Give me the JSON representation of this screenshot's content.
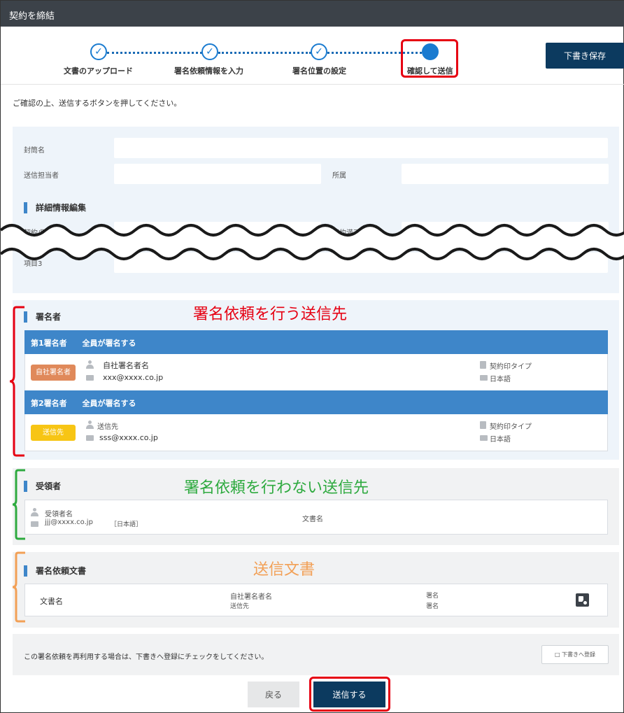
{
  "window": {
    "title": "契約を締結"
  },
  "stepper": {
    "steps": [
      {
        "label": "文書のアップロード",
        "done": true
      },
      {
        "label": "署名依頼情報を入力",
        "done": true
      },
      {
        "label": "署名位置の設定",
        "done": true
      },
      {
        "label": "確認して送信",
        "done": false,
        "current": true
      }
    ],
    "check_glyph": "✓"
  },
  "toolbar": {
    "draft_save_label": "下書き保存"
  },
  "instruction": "ご確認の上、送信するボタンを押してください。",
  "envelope": {
    "envelope_name_label": "封筒名",
    "sender_label": "送信担当者",
    "affiliation_label": "所属",
    "detail_heading": "詳細情報編集",
    "contract_date_label": "契約/取引日",
    "contract_end_label": "契約満了日",
    "item3_label": "項目3"
  },
  "signers": {
    "heading": "署名者",
    "annotation": "署名依頼を行う送信先",
    "list": [
      {
        "order_label": "第1署名者",
        "mode_label": "全員が署名する",
        "badge": "自社署名者",
        "name": "自社署名者名",
        "email": "xxx@xxxx.co.jp",
        "stamp_type": "契約印タイプ",
        "language": "日本語"
      },
      {
        "order_label": "第2署名者",
        "mode_label": "全員が署名する",
        "badge": "送信先",
        "name": "送信先",
        "email": "sss@xxxx.co.jp",
        "stamp_type": "契約印タイプ",
        "language": "日本語"
      }
    ]
  },
  "recipients": {
    "heading": "受領者",
    "annotation": "署名依頼を行わない送信先",
    "name": "受領者名",
    "email": "jjj@xxxx.co.jp",
    "language": "［日本語］",
    "doc_label": "文書名"
  },
  "documents": {
    "heading": "署名依頼文書",
    "annotation": "送信文書",
    "doc_name": "文書名",
    "signer_1": "自社署名者名",
    "signer_2": "送信先",
    "role_1": "署名",
    "role_2": "署名"
  },
  "reuse": {
    "text": "この署名依頼を再利用する場合は、下書きへ登録にチェックをしてください。",
    "checkbox_label": "□ 下書きへ登録"
  },
  "footer": {
    "back_label": "戻る",
    "send_label": "送信する"
  },
  "colors": {
    "accent_blue": "#3e86c9",
    "navy": "#0c3a5f",
    "highlight_red": "#e60012",
    "annotation_green": "#2eaa3f",
    "annotation_orange": "#f2a056"
  }
}
